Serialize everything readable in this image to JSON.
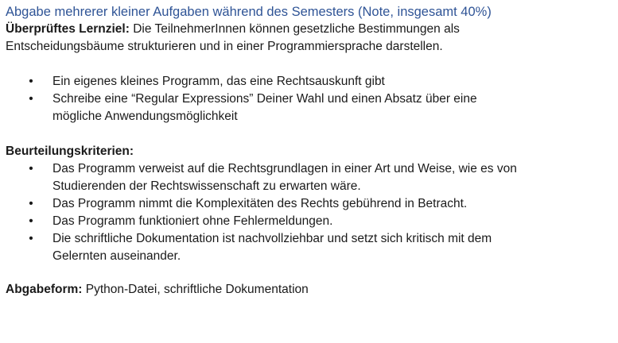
{
  "heading": "Abgabe mehrerer kleiner Aufgaben während des Semesters (Note, insgesamt 40%)",
  "lernziel": {
    "label": "Überprüftes Lernziel:",
    "text_line1": " Die TeilnehmerInnen können gesetzliche Bestimmungen als",
    "text_line2": "Entscheidungsbäume strukturieren und in einer Programmiersprache darstellen."
  },
  "tasks": [
    {
      "line1": "Ein eigenes kleines Programm, das eine Rechtsauskunft gibt",
      "line2": ""
    },
    {
      "line1": "Schreibe eine “Regular Expressions” Deiner Wahl und einen Absatz über eine",
      "line2": "mögliche Anwendungsmöglichkeit"
    }
  ],
  "kriterien": {
    "label": "Beurteilungskriterien:",
    "items": [
      {
        "line1": "Das Programm verweist auf die Rechtsgrundlagen in einer Art und Weise, wie es von",
        "line2": "Studierenden der Rechtswissenschaft zu erwarten wäre."
      },
      {
        "line1": "Das Programm nimmt die Komplexitäten des Rechts gebührend in Betracht.",
        "line2": ""
      },
      {
        "line1": "Das Programm funktioniert ohne Fehlermeldungen.",
        "line2": ""
      },
      {
        "line1": "Die schriftliche Dokumentation ist nachvollziehbar und setzt sich kritisch mit dem",
        "line2": "Gelernten auseinander."
      }
    ]
  },
  "abgabeform": {
    "label": "Abgabeform:",
    "text": " Python-Datei, schriftliche Dokumentation"
  },
  "bullet_glyph": "•",
  "colors": {
    "heading": "#2f5496",
    "text": "#1a1a1a"
  }
}
